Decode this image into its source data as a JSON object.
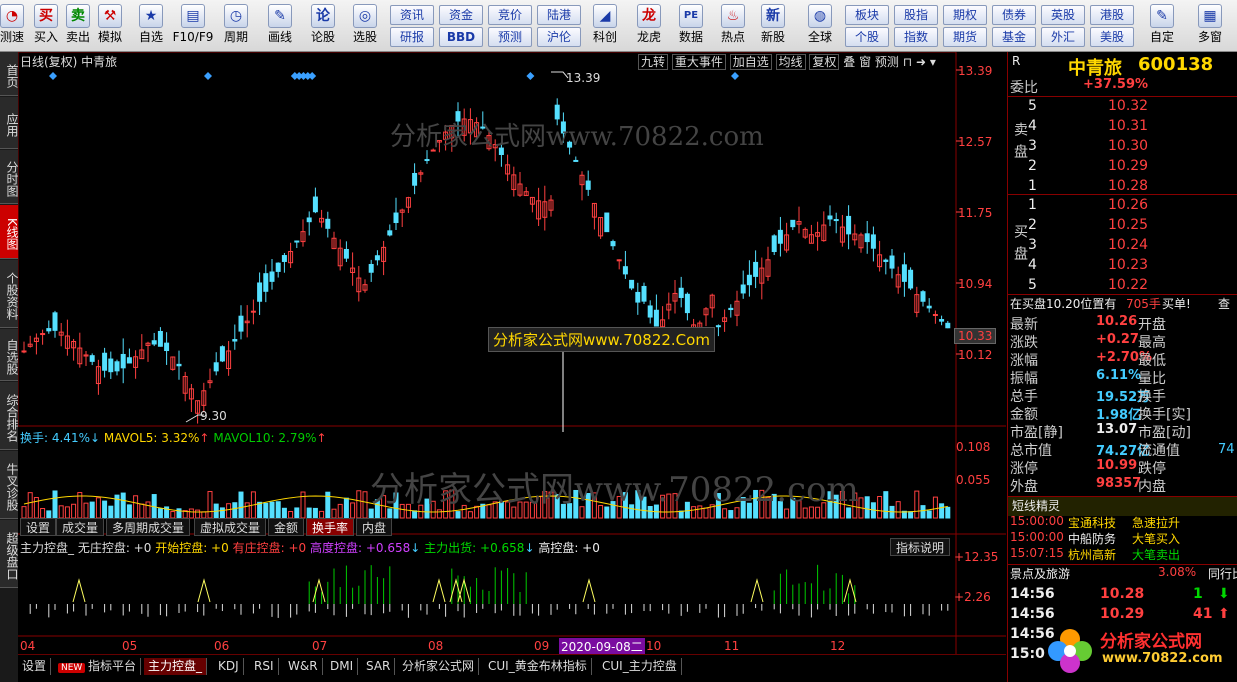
{
  "toolbar": {
    "items": [
      {
        "label": "测速",
        "icon": "speed-icon",
        "glyph": "◔"
      },
      {
        "label": "买入",
        "icon": "buy-icon",
        "glyph": "买"
      },
      {
        "label": "卖出",
        "icon": "sell-icon",
        "glyph": "卖"
      },
      {
        "label": "模拟",
        "icon": "hammer-icon",
        "glyph": "⚒"
      },
      {
        "label": "自选",
        "icon": "star-icon",
        "glyph": "★"
      },
      {
        "label": "F10/F9",
        "icon": "f10-icon",
        "glyph": "▤"
      },
      {
        "label": "周期",
        "icon": "clock-icon",
        "glyph": "◷"
      },
      {
        "label": "画线",
        "icon": "pen-icon",
        "glyph": "✎"
      },
      {
        "label": "论股",
        "icon": "discuss-icon",
        "glyph": "论"
      },
      {
        "label": "选股",
        "icon": "select-stock-icon",
        "glyph": "◎"
      },
      {
        "label": "科创",
        "icon": "star-market-icon",
        "glyph": "◢"
      },
      {
        "label": "龙虎",
        "icon": "dragon-icon",
        "glyph": "龙"
      },
      {
        "label": "数据",
        "icon": "pe-icon",
        "glyph": "PE"
      },
      {
        "label": "热点",
        "icon": "fire-icon",
        "glyph": "♨"
      },
      {
        "label": "新股",
        "icon": "ipo-icon",
        "glyph": "新"
      },
      {
        "label": "全球",
        "icon": "globe-icon",
        "glyph": "◍"
      },
      {
        "label": "自定",
        "icon": "custom-icon",
        "glyph": "✎"
      },
      {
        "label": "多窗",
        "icon": "multiwindow-icon",
        "glyph": "▦"
      }
    ],
    "quick_buttons": [
      "资讯",
      "资金",
      "竞价",
      "陆港",
      "研报",
      "BBD",
      "预测",
      "沪伦",
      "板块",
      "股指",
      "期权",
      "债券",
      "英股",
      "港股",
      "个股",
      "指数",
      "期货",
      "基金",
      "外汇",
      "美股"
    ]
  },
  "sidebar": [
    "首页",
    "应用",
    "分时图",
    "K线图",
    "个股资料",
    "自选股",
    "综合排名",
    "牛叉诊股",
    "超级盘口"
  ],
  "chart": {
    "title": "日线(复权) 中青旅",
    "tools": [
      "九转",
      "重大事件",
      "加自选",
      "均线",
      "复权",
      "叠",
      "窗",
      "预测"
    ],
    "watermark1": "分析家公式网www.70822.com",
    "watermark2": "分析家公式网www.70822.Com",
    "watermark3": "分析家公式网www.70822.com",
    "high_label": "13.39",
    "low_label": "9.30",
    "price_axis": [
      "13.39",
      "12.57",
      "11.75",
      "10.94",
      "10.12"
    ],
    "current_price_tag": "10.33",
    "vol_legend": {
      "a": "换手: 4.41%",
      "b": "MAVOL5: 3.32%",
      "c": "MAVOL10: 2.79%"
    },
    "vol_axis": [
      "0.108",
      "0.055"
    ],
    "vol_tabs": [
      "设置",
      "成交量",
      "多周期成交量",
      "虚拟成交量",
      "金额",
      "换手率",
      "内盘"
    ],
    "ind_legend": {
      "a": "主力控盘_ 无庄控盘: +0",
      "b": "开始控盘: +0",
      "c": "有庄控盘: +0",
      "d": "高度控盘: +0.658",
      "e": "主力出货: +0.658",
      "f": "高控盘: +0"
    },
    "ind_button": "指标说明",
    "ind_axis": [
      "12.35",
      "2.26"
    ],
    "x_axis": [
      "04",
      "05",
      "06",
      "07",
      "08",
      "09",
      "10",
      "11",
      "12"
    ],
    "cursor_date": "2020-09-08二",
    "chart_data": {
      "type": "candlestick",
      "ylim": [
        9.3,
        13.39
      ],
      "high": 13.39,
      "low": 9.3,
      "last": 10.33
    }
  },
  "bottom_tabs": [
    "设置",
    "NEW",
    "指标平台",
    "主力控盘_",
    "KDJ",
    "RSI",
    "W&R",
    "DMI",
    "SAR",
    "分析家公式网",
    "CUI_黄金布林指标",
    "CUI_主力控盘"
  ],
  "quote": {
    "code_prefix": "R",
    "name": "中青旅",
    "code": "600138",
    "wb_label": "委比",
    "wb_value": "+37.59%",
    "sell_label": "卖盘",
    "buy_label": "买盘",
    "sell": [
      [
        "5",
        "10.32"
      ],
      [
        "4",
        "10.31"
      ],
      [
        "3",
        "10.30"
      ],
      [
        "2",
        "10.29"
      ],
      [
        "1",
        "10.28"
      ]
    ],
    "buy": [
      [
        "1",
        "10.26"
      ],
      [
        "2",
        "10.25"
      ],
      [
        "3",
        "10.24"
      ],
      [
        "4",
        "10.23"
      ],
      [
        "5",
        "10.22"
      ]
    ],
    "notice_a": "在买盘10.20位置有",
    "notice_b": "705手",
    "notice_c": "买单!",
    "notice_d": "查",
    "stats": [
      {
        "l": "最新",
        "v": "10.26",
        "l2": "开盘",
        "c": "red"
      },
      {
        "l": "涨跌",
        "v": "+0.27",
        "l2": "最高",
        "c": "red"
      },
      {
        "l": "涨幅",
        "v": "+2.70%",
        "l2": "最低",
        "c": "red"
      },
      {
        "l": "振幅",
        "v": "6.11%",
        "l2": "量比",
        "c": "cyan"
      },
      {
        "l": "总手",
        "v": "19.52万",
        "l2": "换手",
        "c": "cyan"
      },
      {
        "l": "金额",
        "v": "1.98亿",
        "l2": "换手[实]",
        "c": "cyan"
      },
      {
        "l": "市盈[静]",
        "v": "13.07",
        "l2": "市盈[动]",
        "c": "white"
      },
      {
        "l": "总市值",
        "v": "74.27亿",
        "l2": "流通值",
        "c": "cyan"
      },
      {
        "l": "涨停",
        "v": "10.99",
        "l2": "跌停",
        "c": "red"
      },
      {
        "l": "外盘",
        "v": "98357",
        "l2": "内盘",
        "c": "red"
      }
    ],
    "stat_extra": [
      "74"
    ],
    "spirit_title": "短线精灵",
    "spirit": [
      [
        "15:00:00",
        "宝通科技",
        "急速拉升"
      ],
      [
        "15:00:00",
        "中船防务",
        "大笔买入"
      ],
      [
        "15:07:15",
        "杭州高新",
        "大笔卖出"
      ]
    ],
    "sector_name": "景点及旅游",
    "sector_pct": "3.08%",
    "sector_btn": "同行比",
    "ticks": [
      [
        "14:56",
        "10.28",
        "1"
      ],
      [
        "14:56",
        "10.29",
        "41"
      ],
      [
        "14:56",
        "",
        ""
      ],
      [
        "15:0",
        "",
        ""
      ]
    ],
    "logo_text": "分析家公式网",
    "logo_url": "www.70822.com"
  }
}
